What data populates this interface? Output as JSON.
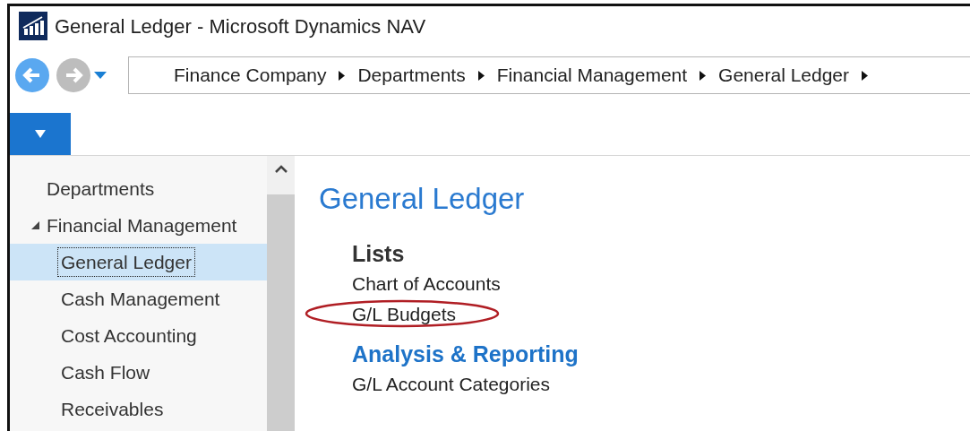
{
  "window": {
    "title": "General Ledger - Microsoft Dynamics NAV"
  },
  "navigation": {
    "back_enabled": true,
    "forward_enabled": false
  },
  "breadcrumb": [
    "Finance Company",
    "Departments",
    "Financial Management",
    "General Ledger"
  ],
  "sidebar": {
    "items": [
      {
        "label": "Departments",
        "selected": false
      },
      {
        "label": "Financial Management",
        "selected": false,
        "expanded": true,
        "children": [
          {
            "label": "General Ledger",
            "selected": true
          },
          {
            "label": "Cash Management",
            "selected": false
          },
          {
            "label": "Cost Accounting",
            "selected": false
          },
          {
            "label": "Cash Flow",
            "selected": false
          },
          {
            "label": "Receivables",
            "selected": false
          }
        ]
      }
    ]
  },
  "page": {
    "title": "General Ledger",
    "sections": [
      {
        "title": "Lists",
        "kind": "plain",
        "links": [
          {
            "label": "Chart of Accounts",
            "circled": false
          },
          {
            "label": "G/L Budgets",
            "circled": true
          }
        ]
      },
      {
        "title": "Analysis & Reporting",
        "kind": "accent",
        "links": [
          {
            "label": "G/L Account Categories",
            "circled": false
          }
        ]
      }
    ]
  }
}
